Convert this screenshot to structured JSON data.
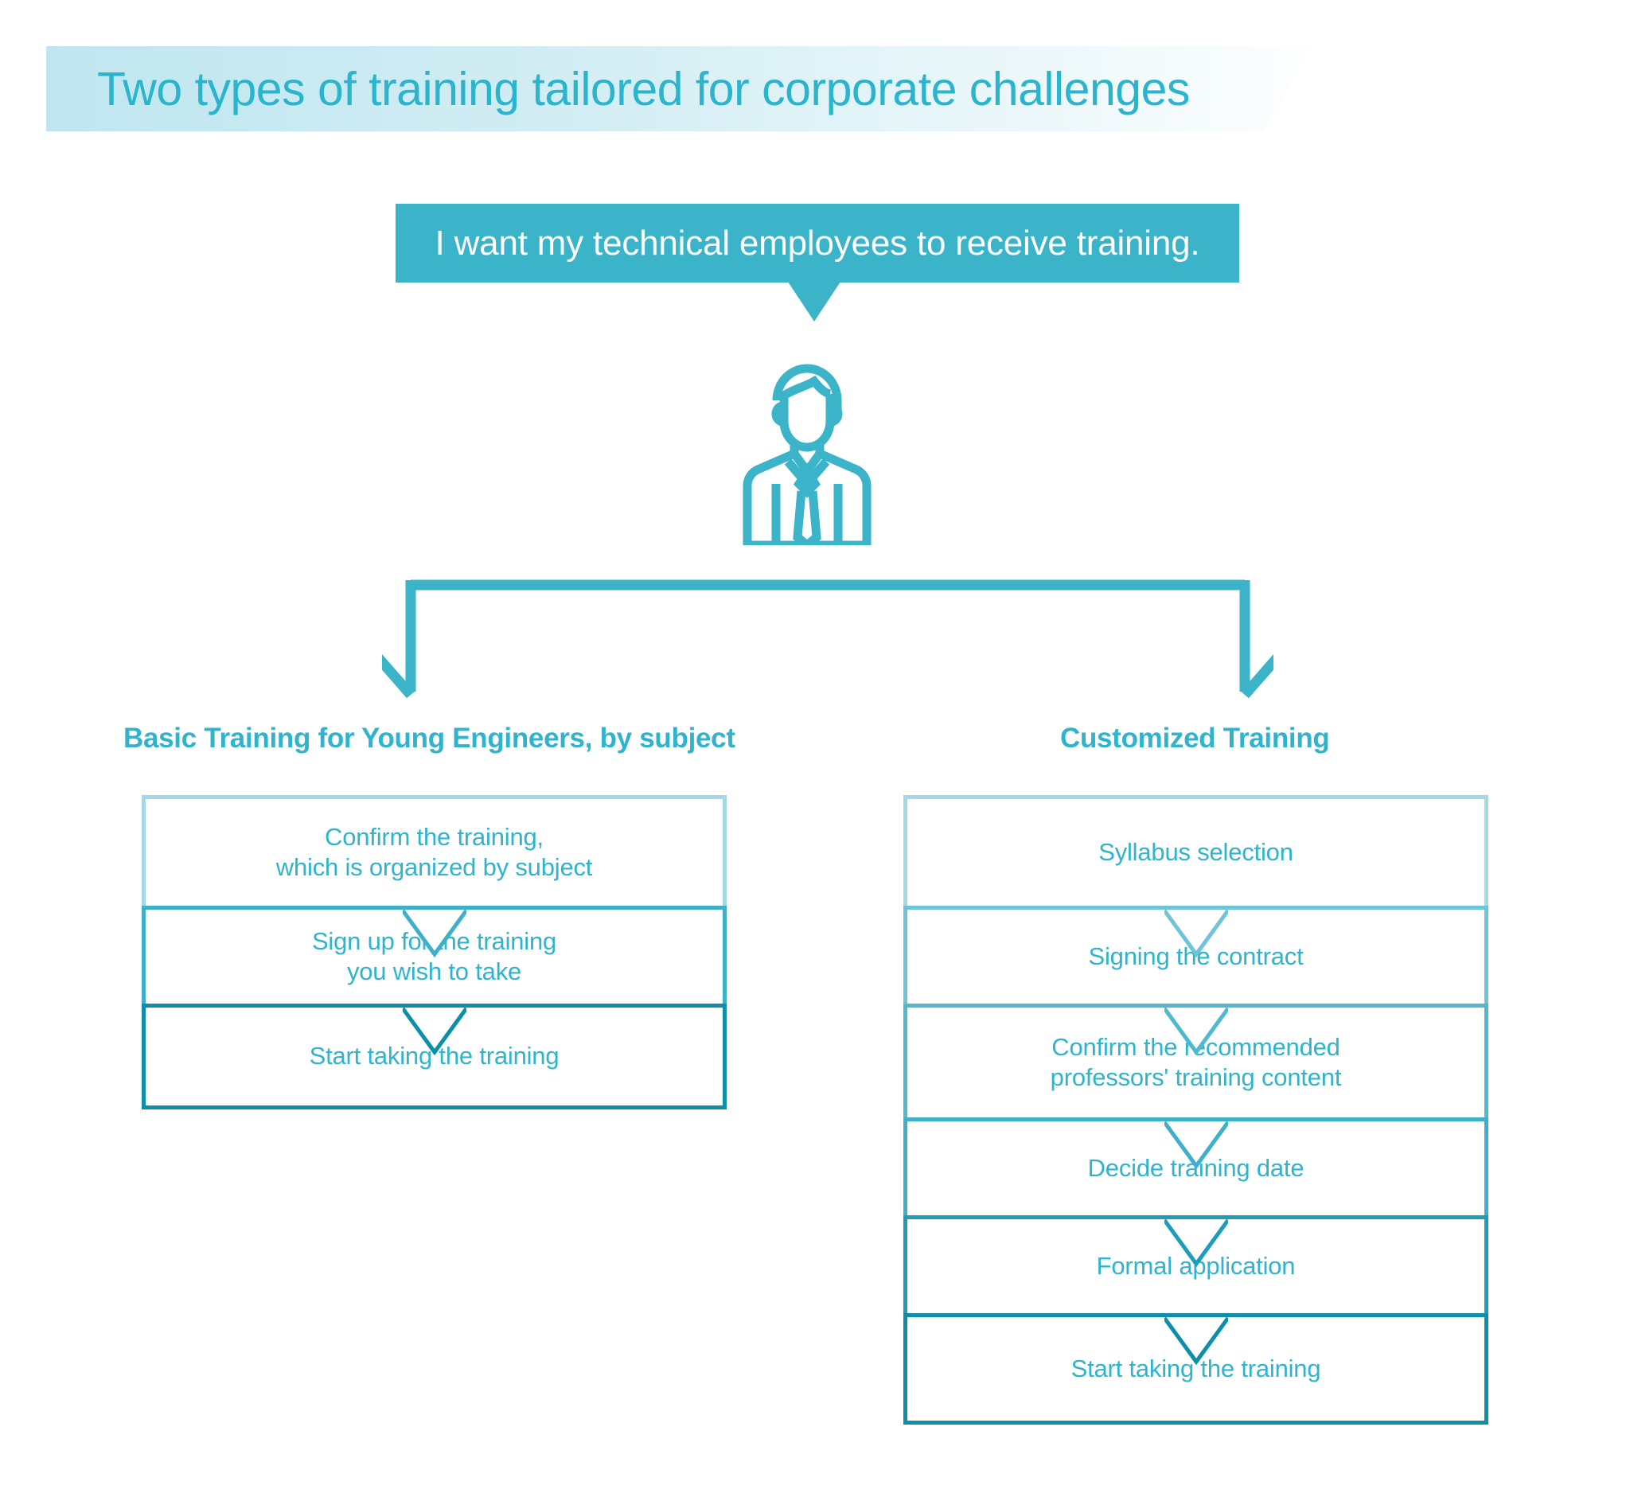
{
  "page": {
    "title": "Two types of training tailored for corporate challenges",
    "background_color": "#ffffff"
  },
  "colors": {
    "brand_cyan": "#2fb4cd",
    "bubble_fill": "#3bb3c9",
    "banner_gradient_start": "#bfe6ef",
    "banner_gradient_end": "#ffffff",
    "border_light": "#a3d8e6",
    "border_mid": "#3fb0c9",
    "border_dark": "#0d8fac"
  },
  "speech_bubble": {
    "text": "I want my technical employees to receive training.",
    "icon": "businessman-icon"
  },
  "connector": {
    "icon": "split-arrow-connector",
    "left_arrow": "arrow-down-left-icon",
    "right_arrow": "arrow-down-right-icon"
  },
  "columns": [
    {
      "heading": "Basic Training for Young Engineers, by subject",
      "steps": [
        {
          "label": "Confirm the training,\nwhich is organized by subject",
          "border": "#a3d8e6",
          "height": 144
        },
        {
          "label": "Sign up for the training\nyou wish to take",
          "border": "#3fb0c9",
          "height": 128
        },
        {
          "label": "Start taking the training",
          "border": "#0d8fac",
          "height": 133
        }
      ]
    },
    {
      "heading": "Customized Training",
      "steps": [
        {
          "label": "Syllabus selection",
          "border": "#a3d8e6",
          "height": 144
        },
        {
          "label": "Signing the contract",
          "border": "#6ec4d8",
          "height": 128
        },
        {
          "label": "Confirm the recommended\nprofessors' training content",
          "border": "#4fb9d0",
          "height": 148
        },
        {
          "label": "Decide training date",
          "border": "#3fb0c9",
          "height": 128
        },
        {
          "label": "Formal application",
          "border": "#1d9dba",
          "height": 128
        },
        {
          "label": "Start taking the training",
          "border": "#0d8fac",
          "height": 140
        }
      ]
    }
  ]
}
